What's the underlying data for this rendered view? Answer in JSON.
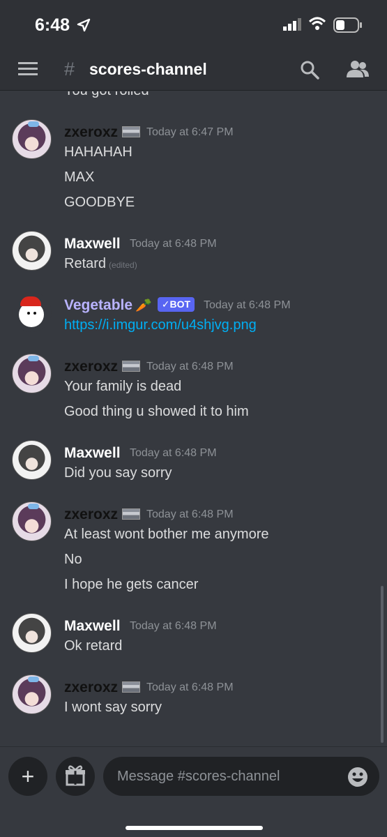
{
  "status_bar": {
    "time": "6:48"
  },
  "header": {
    "hash": "#",
    "channel": "scores-channel"
  },
  "chat": {
    "cutoff_text": "You got rolled",
    "messages": [
      {
        "author": "zxeroxz",
        "timestamp": "Today at 6:47 PM",
        "lines": [
          "HAHAHAH",
          "MAX",
          "GOODBYE"
        ]
      },
      {
        "author": "Maxwell",
        "timestamp": "Today at 6:48 PM",
        "lines": [
          "Retard"
        ],
        "edited": "(edited)"
      },
      {
        "author": "Vegetable",
        "emoji": "🥕",
        "tag": "✓BOT",
        "timestamp": "Today at 6:48 PM",
        "lines": [
          "https://i.imgur.com/u4shjvg.png"
        ]
      },
      {
        "author": "zxeroxz",
        "timestamp": "Today at 6:48 PM",
        "lines": [
          "Your family is dead",
          "Good thing u showed it to him"
        ]
      },
      {
        "author": "Maxwell",
        "timestamp": "Today at 6:48 PM",
        "lines": [
          "Did you say sorry"
        ]
      },
      {
        "author": "zxeroxz",
        "timestamp": "Today at 6:48 PM",
        "lines": [
          "At least wont bother me anymore",
          "No",
          "I hope he gets cancer"
        ]
      },
      {
        "author": "Maxwell",
        "timestamp": "Today at 6:48 PM",
        "lines": [
          "Ok retard"
        ]
      },
      {
        "author": "zxeroxz",
        "timestamp": "Today at 6:48 PM",
        "lines": [
          "I wont say sorry"
        ]
      }
    ]
  },
  "composer": {
    "plus": "+",
    "placeholder": "Message #scores-channel"
  },
  "colors": {
    "background": "#36393f",
    "header": "#2f3136",
    "link": "#00aff4",
    "bot_tag": "#5865f2",
    "bot_name": "#b9b3ff"
  },
  "icons": [
    "location-arrow-icon",
    "signal-icon",
    "wifi-icon",
    "battery-icon",
    "menu-icon",
    "search-icon",
    "members-icon",
    "plus-icon",
    "gift-icon",
    "emoji-icon"
  ]
}
